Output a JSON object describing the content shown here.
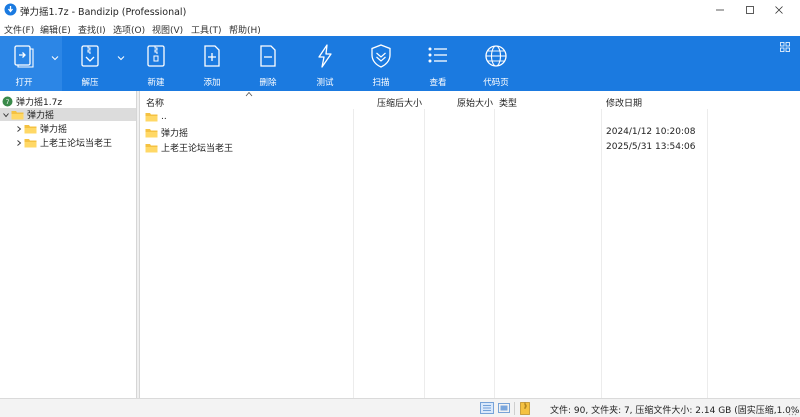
{
  "window": {
    "title": "弹力摇1.7z - Bandizip (Professional)"
  },
  "menu": [
    {
      "label": "文件(F)"
    },
    {
      "label": "编辑(E)"
    },
    {
      "label": "查找(I)"
    },
    {
      "label": "选项(O)"
    },
    {
      "label": "视图(V)"
    },
    {
      "label": "工具(T)"
    },
    {
      "label": "帮助(H)"
    }
  ],
  "toolbar": {
    "open": "打开",
    "extract": "解压",
    "new": "新建",
    "add": "添加",
    "delete": "删除",
    "test": "测试",
    "scan": "扫描",
    "view": "查看",
    "codepage": "代码页"
  },
  "tree": {
    "root": "弹力摇1.7z",
    "items": [
      {
        "label": "弹力摇",
        "expanded": true,
        "selected": true
      },
      {
        "label": "弹力摇"
      },
      {
        "label": "上老王论坛当老王"
      }
    ]
  },
  "list": {
    "columns": {
      "name": "名称",
      "compressed_size": "压缩后大小",
      "original_size": "原始大小",
      "type": "类型",
      "modified": "修改日期"
    },
    "rows": [
      {
        "name": "..",
        "modified": ""
      },
      {
        "name": "弹力摇",
        "modified": "2024/1/12 10:20:08"
      },
      {
        "name": "上老王论坛当老王",
        "modified": "2025/5/31 13:54:06"
      }
    ]
  },
  "status": {
    "text": "文件: 90, 文件夹: 7, 压缩文件大小: 2.14 GB (固实压缩,1.0%)"
  },
  "colors": {
    "toolbar": "#1b7ae0",
    "folder": "#f5c242",
    "selection": "#dcdcdc"
  }
}
